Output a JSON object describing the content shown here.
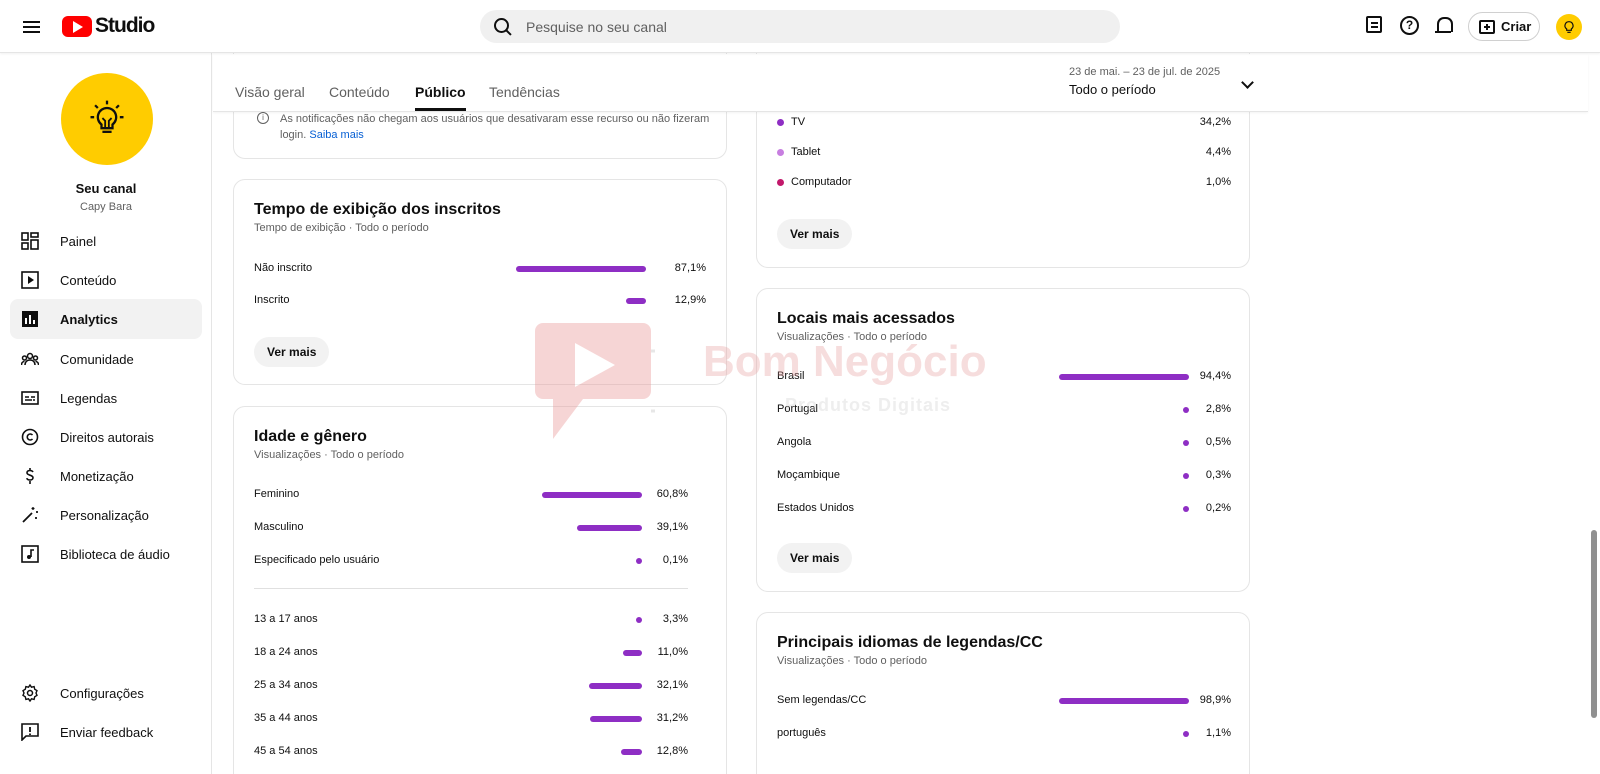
{
  "header": {
    "logo_text": "Studio",
    "search_placeholder": "Pesquise no seu canal",
    "create_label": "Criar"
  },
  "channel": {
    "name": "Seu canal",
    "handle": "Capy Bara"
  },
  "sidebar": {
    "items": [
      {
        "label": "Painel",
        "icon": "dashboard-icon"
      },
      {
        "label": "Conteúdo",
        "icon": "content-icon"
      },
      {
        "label": "Analytics",
        "icon": "analytics-icon",
        "active": true
      },
      {
        "label": "Comunidade",
        "icon": "community-icon"
      },
      {
        "label": "Legendas",
        "icon": "subtitles-icon"
      },
      {
        "label": "Direitos autorais",
        "icon": "copyright-icon"
      },
      {
        "label": "Monetização",
        "icon": "monetization-icon"
      },
      {
        "label": "Personalização",
        "icon": "customization-icon"
      },
      {
        "label": "Biblioteca de áudio",
        "icon": "audio-library-icon"
      }
    ],
    "bottom": [
      {
        "label": "Configurações",
        "icon": "settings-icon"
      },
      {
        "label": "Enviar feedback",
        "icon": "feedback-icon"
      }
    ]
  },
  "tabs": [
    {
      "label": "Visão geral"
    },
    {
      "label": "Conteúdo"
    },
    {
      "label": "Público",
      "active": true
    },
    {
      "label": "Tendências"
    }
  ],
  "date_picker": {
    "range": "23 de mai. – 23 de jul. de 2025",
    "period": "Todo o período"
  },
  "notice": {
    "text": "As notificações não chegam aos usuários que desativaram esse recurso ou não fizeram login.",
    "link": "Saiba mais"
  },
  "subscriber_watch": {
    "title": "Tempo de exibição dos inscritos",
    "subtitle": "Tempo de exibição · Todo o período",
    "rows": [
      {
        "label": "Não inscrito",
        "pct": "87,1%",
        "value": 87.1
      },
      {
        "label": "Inscrito",
        "pct": "12,9%",
        "value": 12.9
      }
    ],
    "more": "Ver mais"
  },
  "age_gender": {
    "title": "Idade e gênero",
    "subtitle": "Visualizações · Todo o período",
    "gender": [
      {
        "label": "Feminino",
        "pct": "60,8%",
        "value": 60.8
      },
      {
        "label": "Masculino",
        "pct": "39,1%",
        "value": 39.1
      },
      {
        "label": "Especificado pelo usuário",
        "pct": "0,1%",
        "value": 0.1
      }
    ],
    "ages": [
      {
        "label": "13 a 17 anos",
        "pct": "3,3%",
        "value": 3.3
      },
      {
        "label": "18 a 24 anos",
        "pct": "11,0%",
        "value": 11.0
      },
      {
        "label": "25 a 34 anos",
        "pct": "32,1%",
        "value": 32.1
      },
      {
        "label": "35 a 44 anos",
        "pct": "31,2%",
        "value": 31.2
      },
      {
        "label": "45 a 54 anos",
        "pct": "12,8%",
        "value": 12.8
      }
    ]
  },
  "devices": {
    "rows": [
      {
        "label": "TV",
        "pct": "34,2%",
        "color": "#8e2ec4"
      },
      {
        "label": "Tablet",
        "pct": "4,4%",
        "color": "#c77ee0"
      },
      {
        "label": "Computador",
        "pct": "1,0%",
        "color": "#c2186b"
      }
    ],
    "more": "Ver mais"
  },
  "locations": {
    "title": "Locais mais acessados",
    "subtitle": "Visualizações · Todo o período",
    "rows": [
      {
        "label": "Brasil",
        "pct": "94,4%",
        "value": 94.4
      },
      {
        "label": "Portugal",
        "pct": "2,8%",
        "value": 2.8
      },
      {
        "label": "Angola",
        "pct": "0,5%",
        "value": 0.5
      },
      {
        "label": "Moçambique",
        "pct": "0,3%",
        "value": 0.3
      },
      {
        "label": "Estados Unidos",
        "pct": "0,2%",
        "value": 0.2
      }
    ],
    "more": "Ver mais"
  },
  "subtitle_languages": {
    "title": "Principais idiomas de legendas/CC",
    "subtitle": "Visualizações · Todo o período",
    "rows": [
      {
        "label": "Sem legendas/CC",
        "pct": "98,9%",
        "value": 98.9
      },
      {
        "label": "português",
        "pct": "1,1%",
        "value": 1.1
      }
    ]
  },
  "watermark": {
    "title": "Bom Negócio",
    "subtitle": "Produtos Digitais"
  },
  "colors": {
    "bar": "#8e2ec4",
    "logo_red": "#ff0000",
    "avatar_yellow": "#ffcc00"
  }
}
